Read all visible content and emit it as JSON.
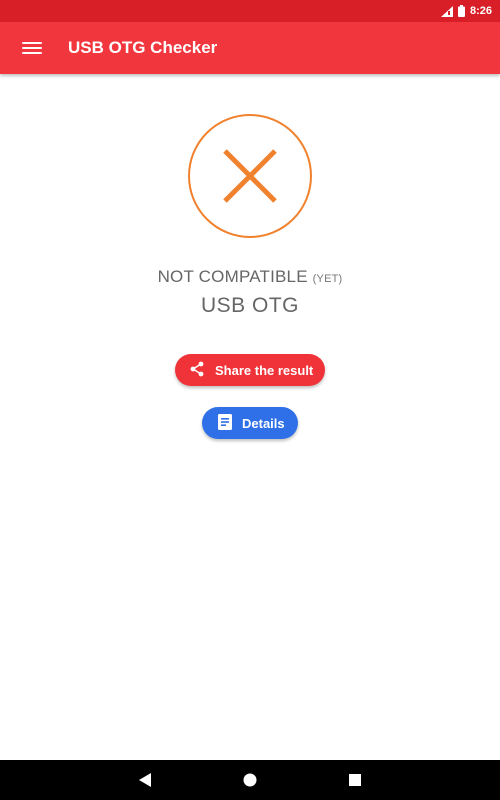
{
  "status_bar": {
    "time": "8:26",
    "signal_icon": "signal-icon",
    "battery_icon": "battery-icon"
  },
  "app_bar": {
    "title": "USB OTG Checker",
    "menu_icon": "menu-icon"
  },
  "result": {
    "icon": "cross-icon",
    "status_text": "NOT COMPATIBLE",
    "status_suffix": "(YET)",
    "subject": "USB OTG"
  },
  "actions": {
    "share_label": "Share the result",
    "details_label": "Details"
  },
  "navigation": {
    "back_icon": "back-icon",
    "home_icon": "home-icon",
    "recents_icon": "recents-icon"
  },
  "colors": {
    "status_bar": "#d81e26",
    "app_bar": "#f1363d",
    "result_orange": "#f0822f",
    "share_button": "#ef3339",
    "details_button": "#2f6fe8",
    "text_gray": "#666666"
  }
}
